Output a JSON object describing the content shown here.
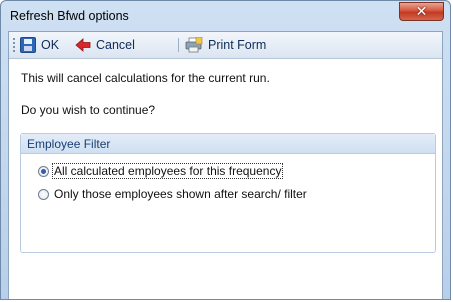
{
  "window": {
    "title": "Refresh Bfwd options",
    "close_glyph": "✕"
  },
  "toolbar": {
    "ok_label": "OK",
    "cancel_label": "Cancel",
    "print_label": "Print Form",
    "icons": [
      "save-icon",
      "back-arrow-icon",
      "print-form-icon"
    ]
  },
  "messages": {
    "line1": "This will cancel calculations for the current run.",
    "line2": "Do you wish to continue?"
  },
  "filter": {
    "header": "Employee Filter",
    "options": [
      {
        "label": "All calculated employees for this frequency",
        "selected": true
      },
      {
        "label": "Only those employees shown after search/ filter",
        "selected": false
      }
    ]
  },
  "colors": {
    "title_bar": "#c4d7ee",
    "toolbar_text": "#0d2c5a",
    "group_header_text": "#173f74",
    "cancel_arrow": "#d8262b"
  }
}
